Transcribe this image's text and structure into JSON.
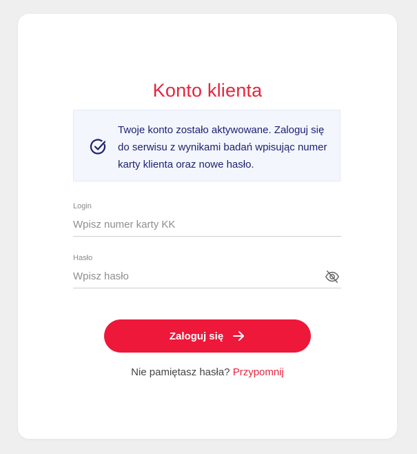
{
  "page": {
    "title": "Konto klienta"
  },
  "info": {
    "icon": "check-circle-icon",
    "text": "Twoje konto zostało aktywowane. Zaloguj się do serwisu z wynikami badań wpisując numer karty klienta oraz nowe hasło."
  },
  "login_field": {
    "label": "Login",
    "placeholder": "Wpisz numer karty KK",
    "value": ""
  },
  "password_field": {
    "label": "Hasło",
    "placeholder": "Wpisz hasło",
    "value": "",
    "toggle_icon": "eye-off-icon"
  },
  "submit": {
    "label": "Zaloguj się",
    "icon": "arrow-right-icon"
  },
  "forgot": {
    "prompt": "Nie pamiętasz hasła?",
    "link": "Przypomnij"
  },
  "colors": {
    "accent": "#ee183b",
    "title": "#e5253d",
    "info_bg": "#f3f6fd",
    "info_text": "#1c1f70"
  }
}
